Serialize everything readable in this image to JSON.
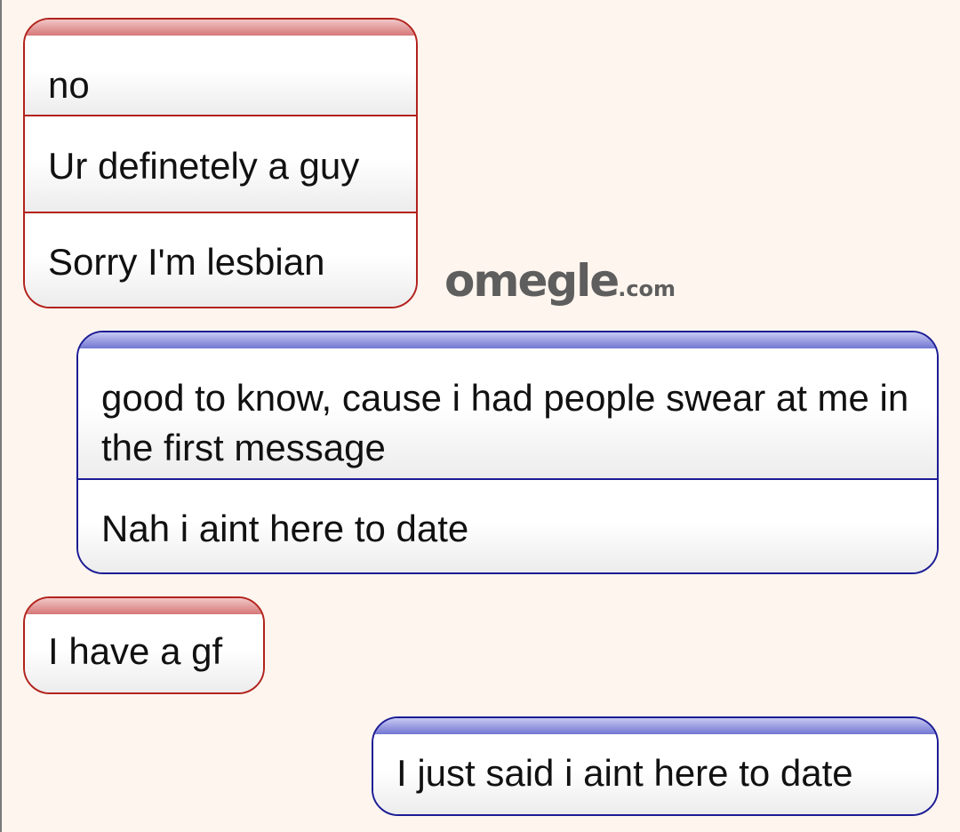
{
  "logo": {
    "main": "omegle",
    "tld": ".com"
  },
  "messages": {
    "group1": [
      "no",
      "Ur definetely a guy",
      "Sorry I'm lesbian"
    ],
    "group2": [
      "good to know, cause i had people swear at me in the first message",
      "Nah i aint here to date"
    ],
    "group3": [
      "I have a gf"
    ],
    "group4": [
      "I just said i aint here to date"
    ]
  },
  "colors": {
    "background": "#fdf5ee",
    "stranger_border": "#b3221d",
    "you_border": "#1c1c96",
    "logo": "#5e5e5e"
  }
}
